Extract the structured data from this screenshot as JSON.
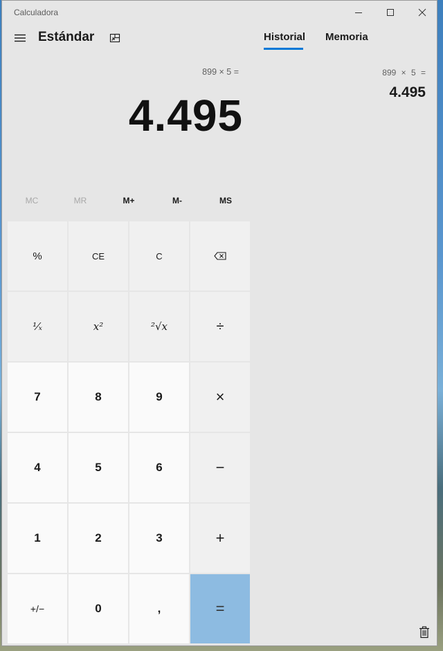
{
  "window": {
    "title": "Calculadora"
  },
  "header": {
    "mode": "Estándar"
  },
  "display": {
    "expression": "899 × 5 =",
    "result": "4.495"
  },
  "memory": [
    {
      "label": "MC",
      "enabled": false
    },
    {
      "label": "MR",
      "enabled": false
    },
    {
      "label": "M+",
      "enabled": true
    },
    {
      "label": "M-",
      "enabled": true
    },
    {
      "label": "MS",
      "enabled": true
    }
  ],
  "keys": [
    [
      "%",
      "CE",
      "C",
      "⌫"
    ],
    [
      "¹⁄ₓ",
      "x²",
      "²√x",
      "÷"
    ],
    [
      "7",
      "8",
      "9",
      "×"
    ],
    [
      "4",
      "5",
      "6",
      "−"
    ],
    [
      "1",
      "2",
      "3",
      "+"
    ],
    [
      "+/−",
      "0",
      ",",
      "="
    ]
  ],
  "panel": {
    "tabs": [
      "Historial",
      "Memoria"
    ],
    "active_tab": "Historial",
    "history": [
      {
        "expression": "899   ×   5 =",
        "result": "4.495"
      }
    ]
  },
  "colors": {
    "accent": "#0078d7",
    "equals_key": "#8dbbe1",
    "window_bg": "#e6e6e6"
  }
}
